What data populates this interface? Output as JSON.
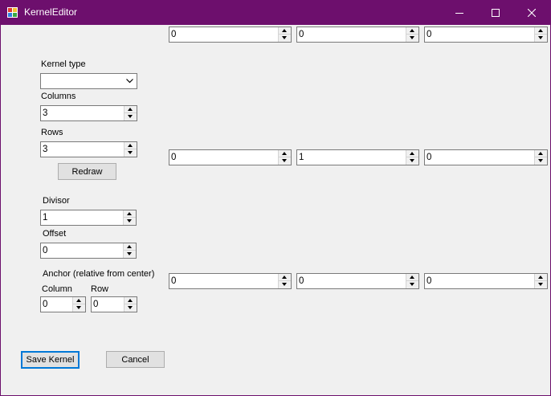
{
  "window": {
    "title": "KernelEditor",
    "titlebar_color": "#6d0f6d"
  },
  "controls": {
    "kernel_type_label": "Kernel type",
    "kernel_type_value": "",
    "columns_label": "Columns",
    "columns_value": "3",
    "rows_label": "Rows",
    "rows_value": "3",
    "redraw_label": "Redraw",
    "divisor_label": "Divisor",
    "divisor_value": "1",
    "offset_label": "Offset",
    "offset_value": "0",
    "anchor_label": "Anchor (relative from center)",
    "anchor_column_label": "Column",
    "anchor_column_value": "0",
    "anchor_row_label": "Row",
    "anchor_row_value": "0"
  },
  "buttons": {
    "save_label": "Save Kernel",
    "cancel_label": "Cancel"
  },
  "kernel": [
    [
      "0",
      "0",
      "0"
    ],
    [
      "0",
      "1",
      "0"
    ],
    [
      "0",
      "0",
      "0"
    ]
  ],
  "icons": {
    "app": "kernel-editor-app-icon",
    "minimize": "minimize-icon",
    "maximize": "maximize-icon",
    "close": "close-icon",
    "dropdown": "chevron-down-icon"
  }
}
